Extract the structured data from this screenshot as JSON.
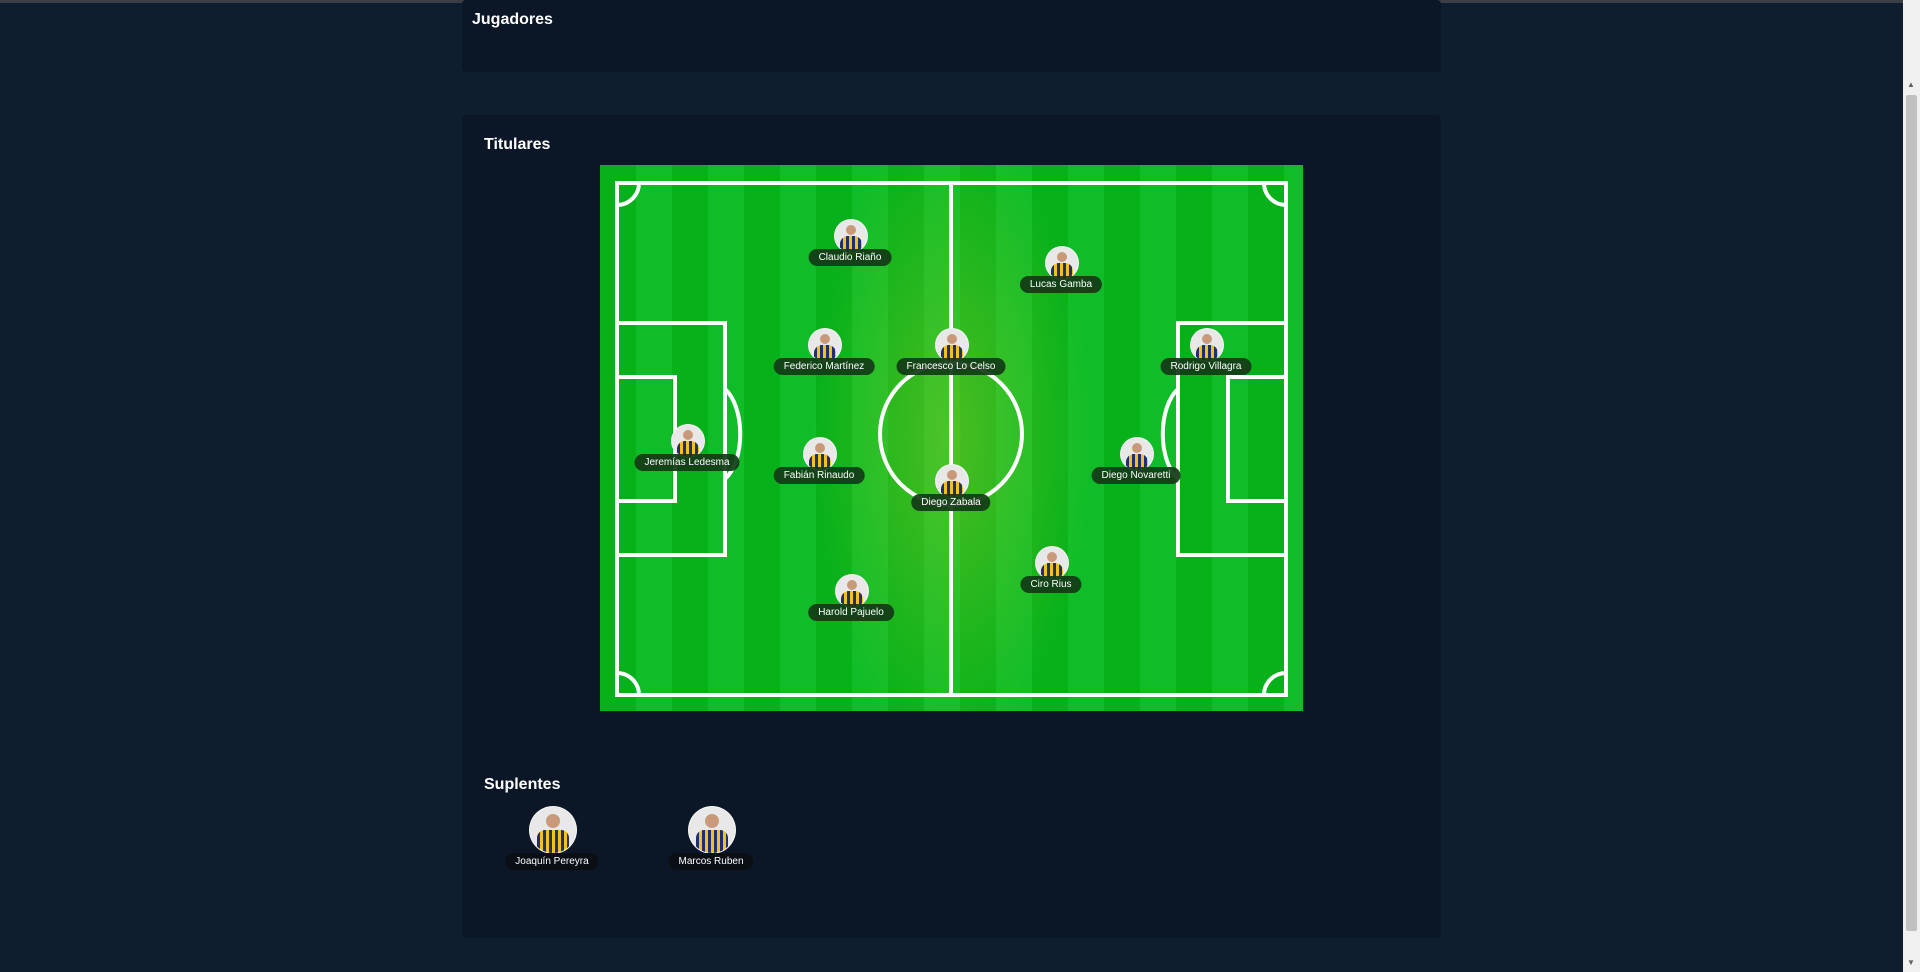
{
  "jugadores": {
    "title": "Jugadores"
  },
  "titulares": {
    "title": "Titulares",
    "players": [
      {
        "name": "Claudio Riaño"
      },
      {
        "name": "Lucas Gamba"
      },
      {
        "name": "Federico Martínez"
      },
      {
        "name": "Francesco Lo Celso"
      },
      {
        "name": "Rodrigo Villagra"
      },
      {
        "name": "Jeremías Ledesma"
      },
      {
        "name": "Fabián Rinaudo"
      },
      {
        "name": "Diego Zabala"
      },
      {
        "name": "Diego Novaretti"
      },
      {
        "name": "Ciro Rius"
      },
      {
        "name": "Harold Pajuelo"
      }
    ]
  },
  "suplentes": {
    "title": "Suplentes",
    "players": [
      {
        "name": "Joaquín Pereyra"
      },
      {
        "name": "Marcos Ruben"
      }
    ]
  },
  "colors": {
    "page_background": "#0f1e2f",
    "card_background": "#0b1726",
    "pitch_green": "#06b11a",
    "label_background": "#123a16"
  }
}
